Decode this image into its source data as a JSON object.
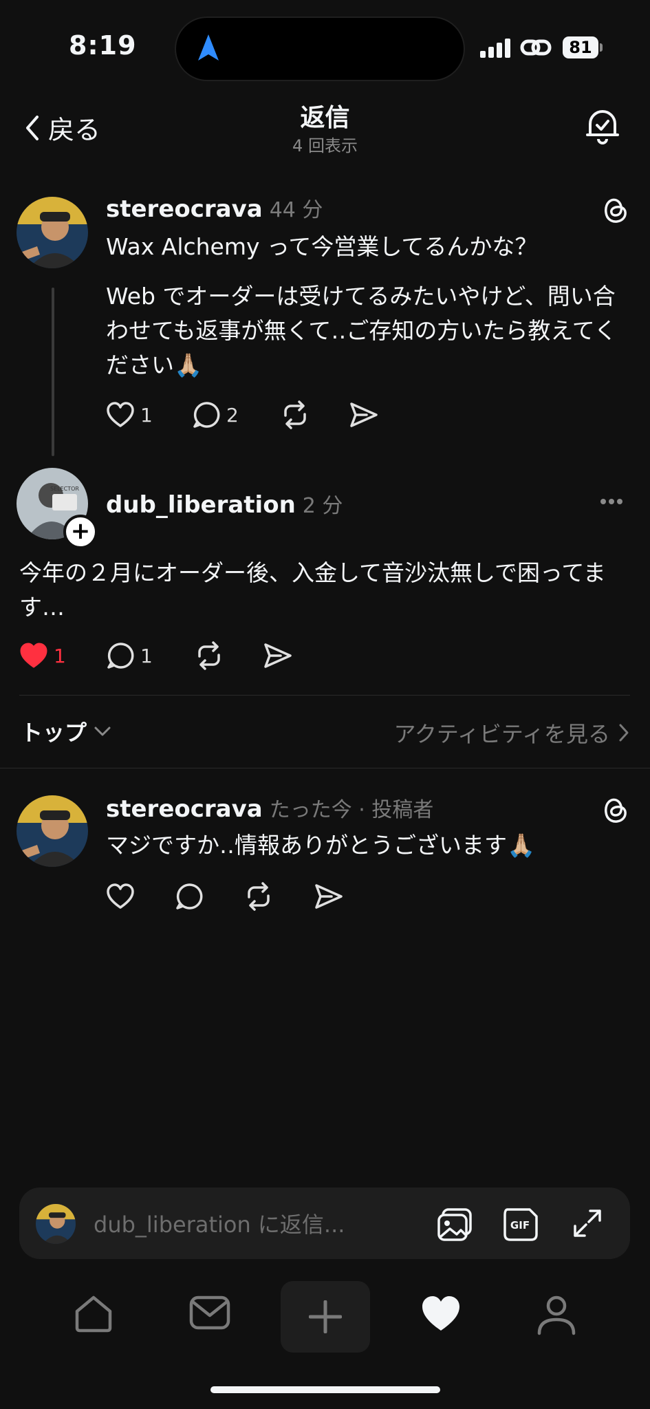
{
  "status_bar": {
    "time": "8:19",
    "battery": "81",
    "icons": [
      "location-arrow-icon",
      "signal-icon",
      "link-icon",
      "battery-icon"
    ]
  },
  "header": {
    "back_label": "戻る",
    "title": "返信",
    "subtitle": "4 回表示"
  },
  "original_post": {
    "username": "stereocrava",
    "time": "44 分",
    "line1": "Wax Alchemy って今営業してるんかな？",
    "line2": "Web でオーダーは受けてるみたいやけど、問い合わせても返事が無くて‥ご存知の方いたら教えてください🙏🏼",
    "likes": "1",
    "replies": "2"
  },
  "focused_reply": {
    "username": "dub_liberation",
    "time": "2 分",
    "text": "今年の２月にオーダー後、入金して音沙汰無しで困ってます…",
    "likes": "1",
    "replies": "1",
    "liked": true
  },
  "sort_bar": {
    "sort_label": "トップ",
    "activity_label": "アクティビティを見る"
  },
  "author_reply": {
    "username": "stereocrava",
    "meta": "たった今 · 投稿者",
    "text": "マジですか‥情報ありがとうございます🙏🏼"
  },
  "composer": {
    "placeholder": "dub_liberation に返信..."
  },
  "colors": {
    "background": "#101010",
    "text": "#f3f5f7",
    "muted": "#7a7a7a",
    "like_red": "#ff3040",
    "location_blue": "#2f8cff"
  }
}
